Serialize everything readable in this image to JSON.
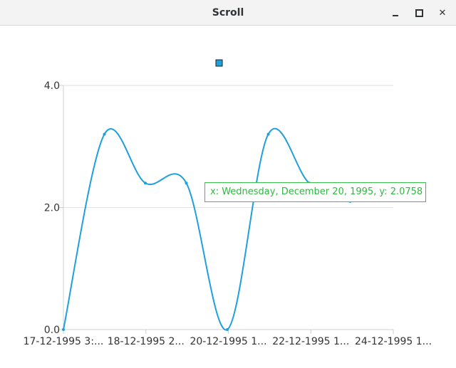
{
  "window": {
    "title": "Scroll",
    "controls": {
      "minimize_icon": "minimize-icon",
      "maximize_icon": "maximize-icon",
      "close_icon": "close-icon",
      "close_glyph": "✕"
    }
  },
  "chart_data": {
    "type": "line",
    "x_tick_labels": [
      "17-12-1995 3:...",
      "18-12-1995 2...",
      "20-12-1995 1...",
      "22-12-1995 1...",
      "24-12-1995 1..."
    ],
    "y_tick_labels": [
      "4.0",
      "2.0",
      "0.0"
    ],
    "ylim": [
      0,
      4
    ],
    "xlim": [
      "17-12-1995",
      "24-12-1995"
    ],
    "grid": true,
    "legend": {
      "position": "top",
      "markers": 1
    },
    "series": [
      {
        "color": "#209fdf",
        "x": [
          "1995-12-17",
          "1995-12-18",
          "1995-12-19",
          "1995-12-20",
          "1995-12-21",
          "1995-12-22",
          "1995-12-23",
          "1995-12-24"
        ],
        "y": [
          0.0,
          3.2,
          2.4,
          2.4,
          0.0,
          3.2,
          2.4,
          2.1
        ]
      }
    ],
    "tooltip": "x: Wednesday, December 20, 1995, y: 2.0758"
  }
}
